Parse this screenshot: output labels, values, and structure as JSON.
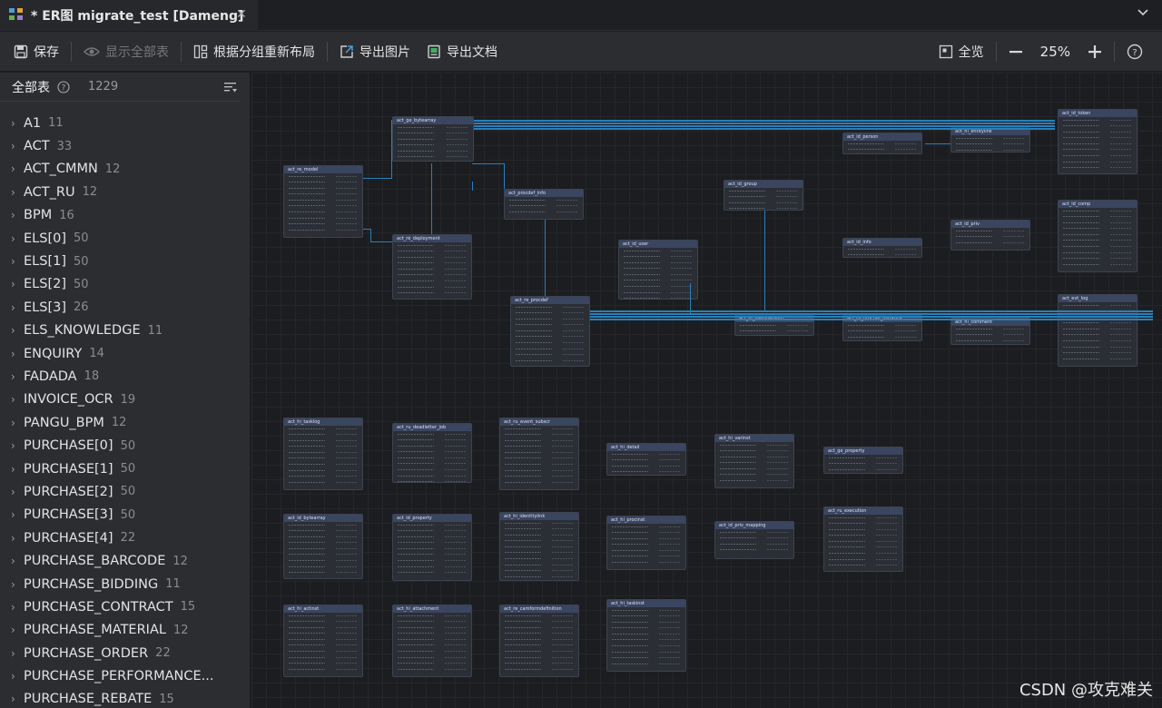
{
  "tab": {
    "title": "* ER图 migrate_test [Dameng]"
  },
  "toolbar": {
    "save": "保存",
    "show_all": "显示全部表",
    "relayout": "根据分组重新布局",
    "export_image": "导出图片",
    "export_doc": "导出文档",
    "overview": "全览",
    "zoom": "25%"
  },
  "sidebar": {
    "title": "全部表",
    "count": "1229",
    "items": [
      {
        "name": "A1",
        "count": "11"
      },
      {
        "name": "ACT",
        "count": "33"
      },
      {
        "name": "ACT_CMMN",
        "count": "12"
      },
      {
        "name": "ACT_RU",
        "count": "12"
      },
      {
        "name": "BPM",
        "count": "16"
      },
      {
        "name": "ELS[0]",
        "count": "50"
      },
      {
        "name": "ELS[1]",
        "count": "50"
      },
      {
        "name": "ELS[2]",
        "count": "50"
      },
      {
        "name": "ELS[3]",
        "count": "26"
      },
      {
        "name": "ELS_KNOWLEDGE",
        "count": "11"
      },
      {
        "name": "ENQUIRY",
        "count": "14"
      },
      {
        "name": "FADADA",
        "count": "18"
      },
      {
        "name": "INVOICE_OCR",
        "count": "19"
      },
      {
        "name": "PANGU_BPM",
        "count": "12"
      },
      {
        "name": "PURCHASE[0]",
        "count": "50"
      },
      {
        "name": "PURCHASE[1]",
        "count": "50"
      },
      {
        "name": "PURCHASE[2]",
        "count": "50"
      },
      {
        "name": "PURCHASE[3]",
        "count": "50"
      },
      {
        "name": "PURCHASE[4]",
        "count": "22"
      },
      {
        "name": "PURCHASE_BARCODE",
        "count": "12"
      },
      {
        "name": "PURCHASE_BIDDING",
        "count": "11"
      },
      {
        "name": "PURCHASE_CONTRACT",
        "count": "15"
      },
      {
        "name": "PURCHASE_MATERIAL",
        "count": "12"
      },
      {
        "name": "PURCHASE_ORDER",
        "count": "22"
      },
      {
        "name": "PURCHASE_PERFORMANCE...",
        "count": ""
      },
      {
        "name": "PURCHASE_REBATE",
        "count": "15"
      }
    ]
  },
  "entities": [
    "act_ge_bytearray",
    "act_re_model",
    "act_procdef_info",
    "act_id_group",
    "act_id_user",
    "act_re_deployment",
    "act_re_procdef",
    "act_id_membership",
    "act_id_info",
    "act_id_priv",
    "act_id_token",
    "act_hi_tasklog",
    "act_ru_deadletter_job",
    "act_ru_event_subscr",
    "act_hi_comment",
    "act_hi_detail",
    "act_ge_property",
    "act_id_bytearray",
    "act_id_property",
    "act_hi_identitylink",
    "act_hi_varinst",
    "act_hi_procinst",
    "act_hi_actinst",
    "act_hi_attachment",
    "act_re_camformdefinition",
    "act_hi_taskinst",
    "act_id_priv_mapping",
    "act_hi_entitylink",
    "act_id_person",
    "act_id_comp",
    "act_evt_log",
    "act_ru_execution",
    "act_ru_procdef_instance_model",
    "act_temp",
    "act_ru_procdef_instance",
    "act_fo_databasechangelog",
    "act_fo_databasechangeloglock"
  ],
  "watermark": "CSDN @攻克难关"
}
